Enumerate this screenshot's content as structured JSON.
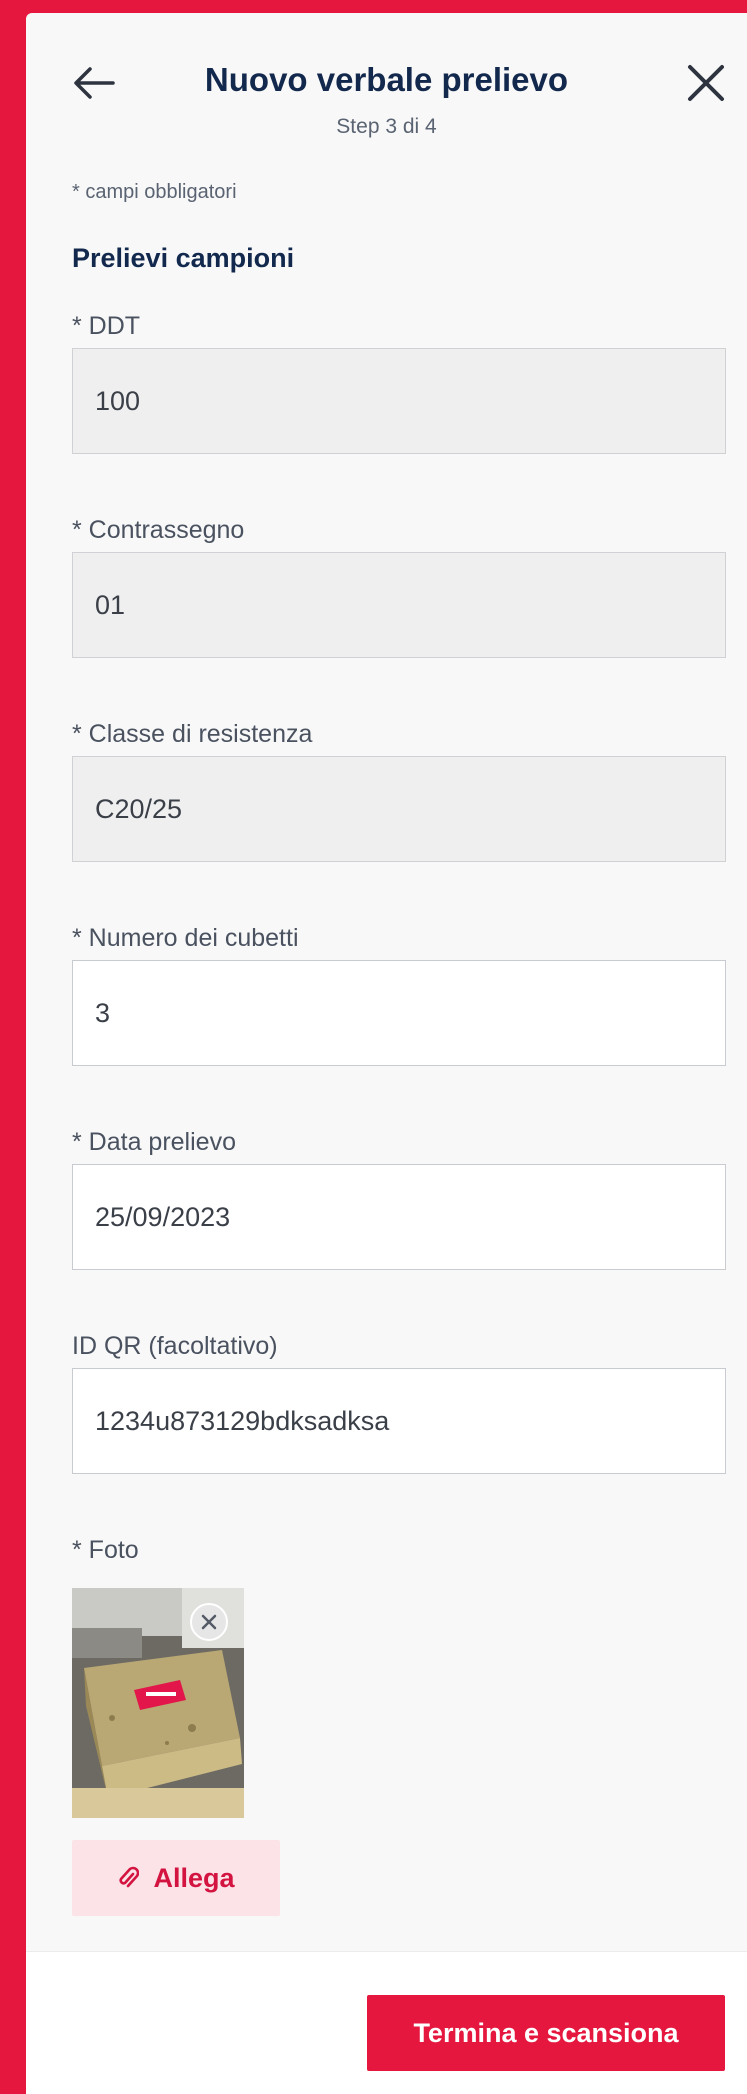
{
  "header": {
    "title": "Nuovo verbale prelievo",
    "subtitle": "Step 3 di 4",
    "back_icon": "arrow-left-icon",
    "close_icon": "close-icon"
  },
  "form": {
    "required_note": "* campi obbligatori",
    "section_title": "Prelievi campioni",
    "fields": [
      {
        "label": "* DDT",
        "value": "100",
        "disabled": true
      },
      {
        "label": "* Contrassegno",
        "value": "01",
        "disabled": true
      },
      {
        "label": "* Classe di resistenza",
        "value": "C20/25",
        "disabled": true
      },
      {
        "label": "* Numero dei cubetti",
        "value": "3",
        "disabled": false
      },
      {
        "label": "* Data prelievo",
        "value": "25/09/2023",
        "disabled": false
      },
      {
        "label": "ID QR (facoltativo)",
        "value": "1234u873129bdksadksa",
        "disabled": false
      }
    ],
    "photo_label": "* Foto",
    "attach_label": "Allega",
    "attach_icon": "paperclip-icon"
  },
  "footer": {
    "primary_label": "Termina e scansiona"
  },
  "colors": {
    "brand": "#e5173f",
    "navy": "#12284c",
    "attach_bg": "#fbe3e8"
  }
}
